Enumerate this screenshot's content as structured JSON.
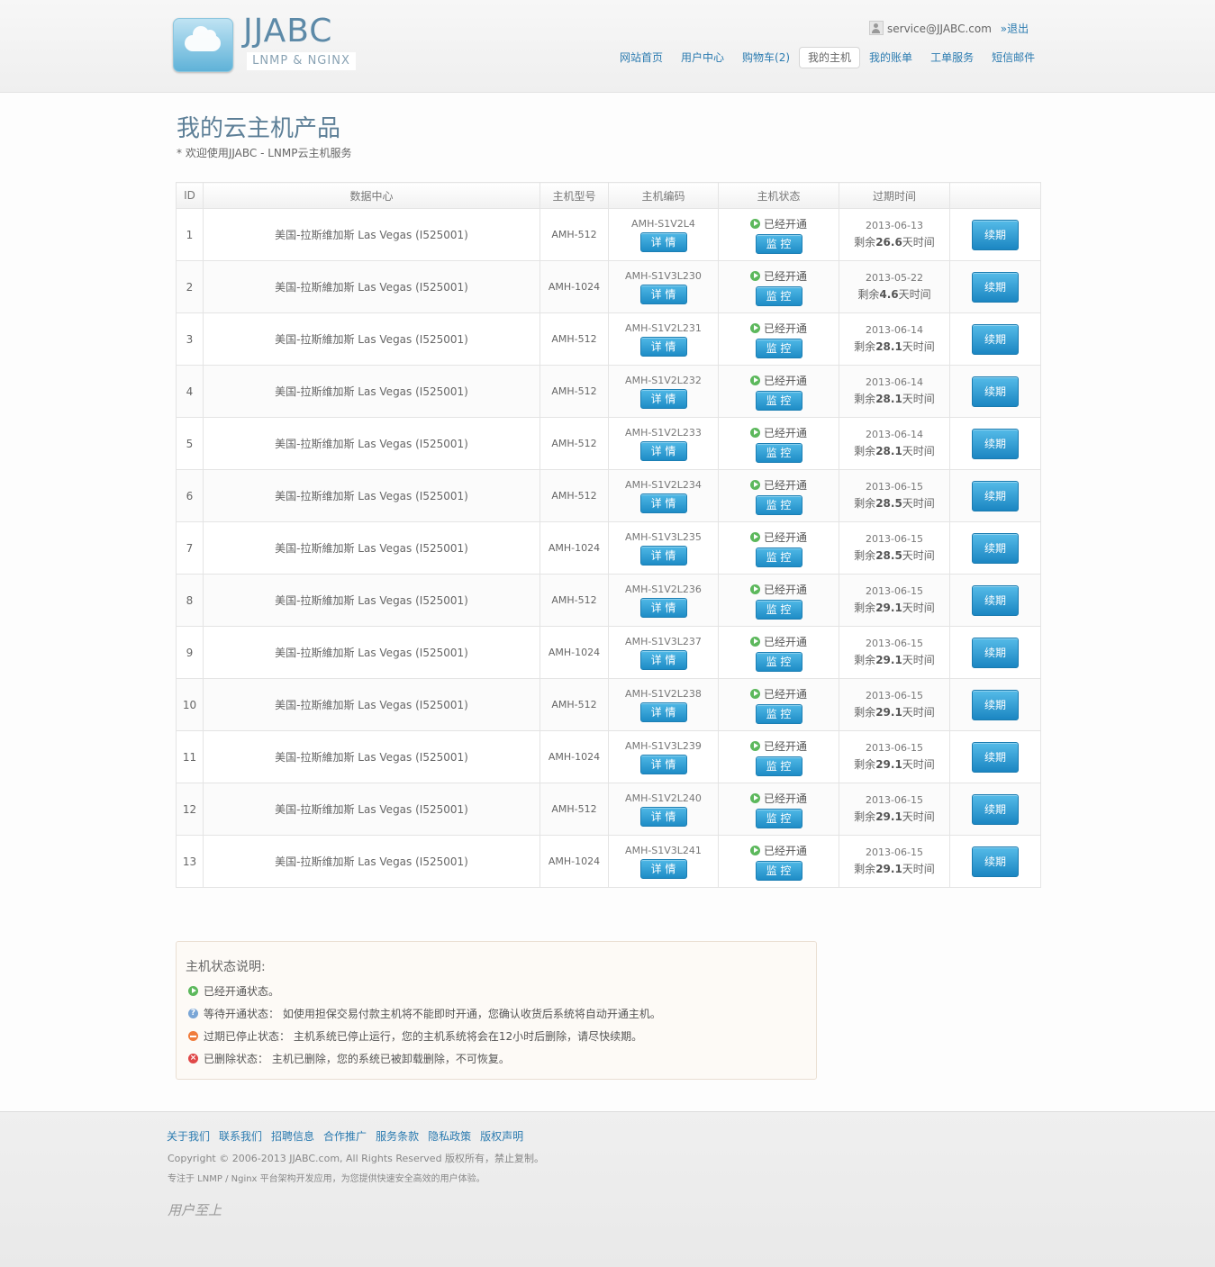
{
  "header": {
    "logo_title": "JJABC",
    "logo_sub": "LNMP & NGINX",
    "user_email": "service@JJABC.com",
    "logout_prefix": "»",
    "logout": "退出",
    "nav": [
      {
        "label": "网站首页",
        "active": false
      },
      {
        "label": "用户中心",
        "active": false
      },
      {
        "label": "购物车(2)",
        "active": false
      },
      {
        "label": "我的主机",
        "active": true
      },
      {
        "label": "我的账单",
        "active": false
      },
      {
        "label": "工单服务",
        "active": false
      },
      {
        "label": "短信邮件",
        "active": false
      }
    ]
  },
  "page": {
    "title": "我的云主机产品",
    "subtitle": "* 欢迎使用JJABC - LNMP云主机服务"
  },
  "table": {
    "headers": [
      "ID",
      "数据中心",
      "主机型号",
      "主机编码",
      "主机状态",
      "过期时间",
      ""
    ],
    "detail_label": "详 情",
    "monitor_label": "监 控",
    "renew_label": "续期",
    "remain_prefix": "剩余",
    "remain_suffix": "天时间",
    "rows": [
      {
        "id": "1",
        "dc": "美国-拉斯维加斯 Las Vegas (I525001)",
        "model": "AMH-512",
        "code": "AMH-S1V2L4",
        "status": "已经开通",
        "date": "2013-06-13",
        "remain": "26.6"
      },
      {
        "id": "2",
        "dc": "美国-拉斯維加斯 Las Vegas (I525001)",
        "model": "AMH-1024",
        "code": "AMH-S1V3L230",
        "status": "已经开通",
        "date": "2013-05-22",
        "remain": "4.6"
      },
      {
        "id": "3",
        "dc": "美国-拉斯維加斯 Las Vegas (I525001)",
        "model": "AMH-512",
        "code": "AMH-S1V2L231",
        "status": "已经开通",
        "date": "2013-06-14",
        "remain": "28.1"
      },
      {
        "id": "4",
        "dc": "美国-拉斯维加斯 Las Vegas (I525001)",
        "model": "AMH-512",
        "code": "AMH-S1V2L232",
        "status": "已经开通",
        "date": "2013-06-14",
        "remain": "28.1"
      },
      {
        "id": "5",
        "dc": "美国-拉斯维加斯 Las Vegas (I525001)",
        "model": "AMH-512",
        "code": "AMH-S1V2L233",
        "status": "已经开通",
        "date": "2013-06-14",
        "remain": "28.1"
      },
      {
        "id": "6",
        "dc": "美国-拉斯维加斯 Las Vegas (I525001)",
        "model": "AMH-512",
        "code": "AMH-S1V2L234",
        "status": "已经开通",
        "date": "2013-06-15",
        "remain": "28.5"
      },
      {
        "id": "7",
        "dc": "美国-拉斯維加斯 Las Vegas (I525001)",
        "model": "AMH-1024",
        "code": "AMH-S1V3L235",
        "status": "已经开通",
        "date": "2013-06-15",
        "remain": "28.5"
      },
      {
        "id": "8",
        "dc": "美国-拉斯維加斯 Las Vegas (I525001)",
        "model": "AMH-512",
        "code": "AMH-S1V2L236",
        "status": "已经开通",
        "date": "2013-06-15",
        "remain": "29.1"
      },
      {
        "id": "9",
        "dc": "美国-拉斯維加斯 Las Vegas (I525001)",
        "model": "AMH-1024",
        "code": "AMH-S1V3L237",
        "status": "已经开通",
        "date": "2013-06-15",
        "remain": "29.1"
      },
      {
        "id": "10",
        "dc": "美国-拉斯維加斯 Las Vegas (I525001)",
        "model": "AMH-512",
        "code": "AMH-S1V2L238",
        "status": "已经开通",
        "date": "2013-06-15",
        "remain": "29.1"
      },
      {
        "id": "11",
        "dc": "美国-拉斯維加斯 Las Vegas (I525001)",
        "model": "AMH-1024",
        "code": "AMH-S1V3L239",
        "status": "已经开通",
        "date": "2013-06-15",
        "remain": "29.1"
      },
      {
        "id": "12",
        "dc": "美国-拉斯维加斯 Las Vegas (I525001)",
        "model": "AMH-512",
        "code": "AMH-S1V2L240",
        "status": "已经开通",
        "date": "2013-06-15",
        "remain": "29.1"
      },
      {
        "id": "13",
        "dc": "美国-拉斯维加斯 Las Vegas (I525001)",
        "model": "AMH-1024",
        "code": "AMH-S1V3L241",
        "status": "已经开通",
        "date": "2013-06-15",
        "remain": "29.1"
      }
    ]
  },
  "legend": {
    "title": "主机状态说明:",
    "items": [
      {
        "icon": "play-circle-icon",
        "text": "已经开通状态。"
      },
      {
        "icon": "question-circle-icon",
        "text": "等待开通状态： 如使用担保交易付款主机将不能即时开通，您确认收货后系统将自动开通主机。"
      },
      {
        "icon": "minus-circle-icon",
        "text": "过期已停止状态： 主机系统已停止运行，您的主机系统将会在12小时后删除，请尽快续期。"
      },
      {
        "icon": "x-circle-icon",
        "text": "已删除状态： 主机已删除，您的系统已被卸载删除，不可恢复。"
      }
    ]
  },
  "footer": {
    "links": [
      "关于我们",
      "联系我们",
      "招聘信息",
      "合作推广",
      "服务条款",
      "隐私政策",
      "版权声明"
    ],
    "copyright": "Copyright © 2006-2013 JJABC.com, All Rights Reserved 版权所有，禁止复制。",
    "desc": "专注于 LNMP / Nginx 平台架构开发应用，为您提供快速安全高效的用户体验。",
    "sign": "用户至上"
  }
}
